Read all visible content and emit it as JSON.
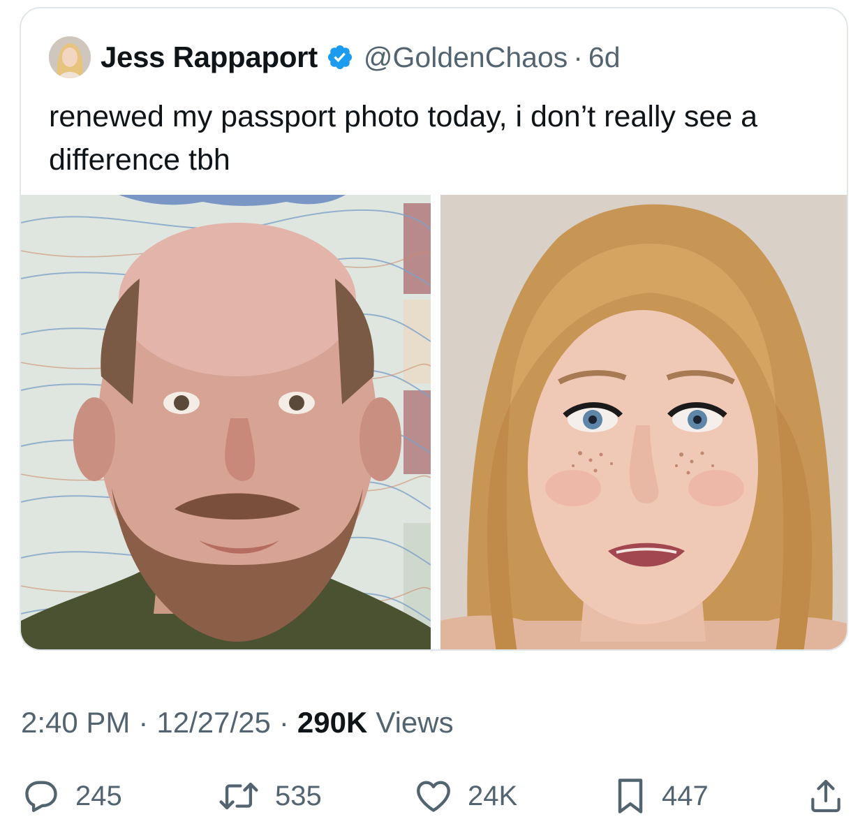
{
  "tweet": {
    "author": {
      "display_name": "Jess Rappaport",
      "handle": "@GoldenChaos",
      "verified": true,
      "age": "6d"
    },
    "text": "renewed my passport photo today, i don’t really see a difference tbh",
    "media": [
      {
        "label": "passport-photo"
      },
      {
        "label": "selfie-photo"
      }
    ]
  },
  "meta": {
    "time": "2:40 PM",
    "date": "12/27/25",
    "separator": "·",
    "views_count": "290K",
    "views_label": "Views"
  },
  "actions": {
    "replies": {
      "icon": "reply-icon",
      "count": "245"
    },
    "reposts": {
      "icon": "repost-icon",
      "count": "535"
    },
    "likes": {
      "icon": "heart-icon",
      "count": "24K"
    },
    "bookmarks": {
      "icon": "bookmark-icon",
      "count": "447"
    },
    "share": {
      "icon": "share-icon"
    }
  },
  "colors": {
    "text_primary": "#0f1419",
    "text_secondary": "#536471",
    "verified_blue": "#1d9bf0",
    "border": "#e1e6ea"
  }
}
